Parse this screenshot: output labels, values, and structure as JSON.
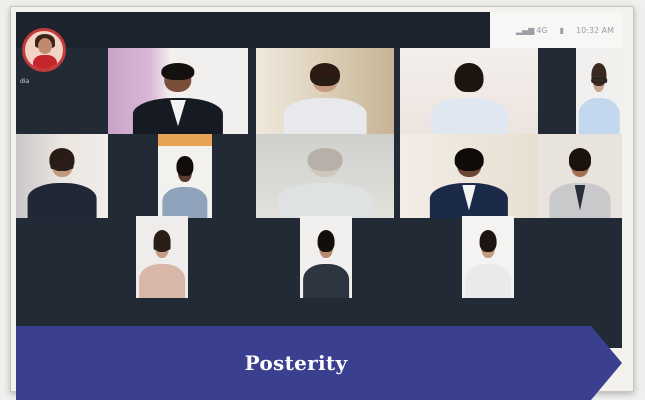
{
  "meeting": {
    "status_bar": {
      "signal_label": "4G",
      "battery_label": "▮",
      "time": "10:32 AM"
    },
    "participants": [
      {
        "label": "dia"
      },
      {
        "label": ""
      }
    ]
  },
  "banner": {
    "title": "Posterity",
    "color": "#3b3f8f"
  }
}
